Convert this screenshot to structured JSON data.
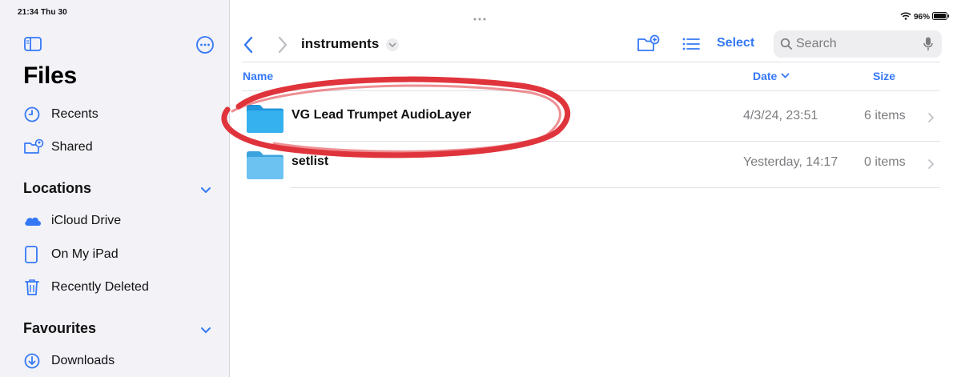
{
  "status": {
    "time_date": "21:34  Thu 30",
    "battery": "96%"
  },
  "sidebar": {
    "title": "Files",
    "top_items": [
      {
        "label": "Recents",
        "icon": "clock-icon"
      },
      {
        "label": "Shared",
        "icon": "shared-folder-icon"
      }
    ],
    "locations": {
      "heading": "Locations",
      "items": [
        {
          "label": "iCloud Drive",
          "icon": "cloud-icon"
        },
        {
          "label": "On My iPad",
          "icon": "ipad-icon"
        },
        {
          "label": "Recently Deleted",
          "icon": "trash-icon"
        }
      ]
    },
    "favourites": {
      "heading": "Favourites",
      "items": [
        {
          "label": "Downloads",
          "icon": "download-icon"
        }
      ]
    }
  },
  "toolbar": {
    "folder_title": "instruments",
    "select_label": "Select",
    "search_placeholder": "Search"
  },
  "columns": {
    "name": "Name",
    "date": "Date",
    "size": "Size"
  },
  "files": [
    {
      "name": "VG Lead Trumpet AudioLayer",
      "date": "4/3/24, 23:51",
      "size": "6 items",
      "highlighted": true
    },
    {
      "name": "setlist",
      "date": "Yesterday, 14:17",
      "size": "0 items",
      "highlighted": false
    }
  ],
  "colors": {
    "accent": "#3478f6",
    "folder": "#2ea8ec",
    "highlight_ring": "#e0343c",
    "sidebar_bg": "#f2f2f7"
  }
}
